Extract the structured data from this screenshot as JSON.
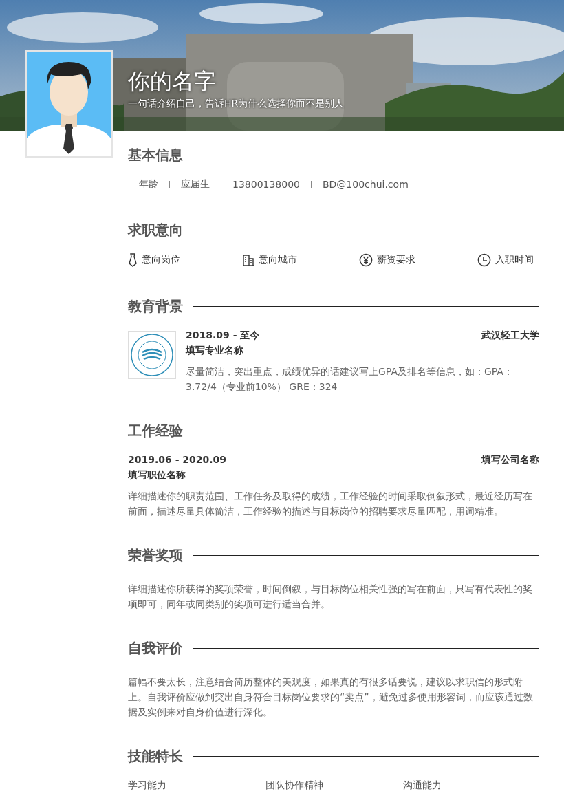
{
  "header": {
    "name": "你的名字",
    "tagline": "一句话介绍自己，告诉HR为什么选择你而不是别人"
  },
  "sections": [
    {
      "kind": "info",
      "title": "基本信息",
      "items": [
        "年龄",
        "应届生",
        "13800138000",
        "BD@100chui.com"
      ]
    },
    {
      "kind": "intention",
      "title": "求职意向",
      "items": [
        {
          "kind": "tie",
          "label": "意向岗位"
        },
        {
          "kind": "building",
          "label": "意向城市"
        },
        {
          "kind": "yen",
          "label": "薪资要求"
        },
        {
          "kind": "clock",
          "label": "入职时间"
        }
      ]
    },
    {
      "kind": "education",
      "title": "教育背景",
      "date": "2018.09 - 至今",
      "school": "武汉轻工大学",
      "major": "填写专业名称",
      "text": "尽量简洁，突出重点，成绩优异的话建议写上GPA及排名等信息，如：GPA：3.72/4（专业前10%） GRE：324"
    },
    {
      "kind": "work",
      "title": "工作经验",
      "date": "2019.06 - 2020.09",
      "company": "填写公司名称",
      "position": "填写职位名称",
      "text": "详细描述你的职责范围、工作任务及取得的成绩，工作经验的时间采取倒叙形式，最近经历写在前面，描述尽量具体简洁，工作经验的描述与目标岗位的招聘要求尽量匹配，用词精准。"
    },
    {
      "kind": "text",
      "title": "荣誉奖项",
      "text": "详细描述你所获得的奖项荣誉，时间倒叙，与目标岗位相关性强的写在前面，只写有代表性的奖项即可，同年或同类别的奖项可进行适当合并。"
    },
    {
      "kind": "text",
      "title": "自我评价",
      "text": "篇幅不要太长，注意结合简历整体的美观度，如果真的有很多话要说，建议以求职信的形式附上。自我评价应做到突出自身符合目标岗位要求的“卖点”，避免过多使用形容词，而应该通过数据及实例来对自身价值进行深化。"
    },
    {
      "kind": "skills",
      "title": "技能特长",
      "items": [
        "学习能力",
        "团队协作精神",
        "沟通能力"
      ]
    }
  ]
}
